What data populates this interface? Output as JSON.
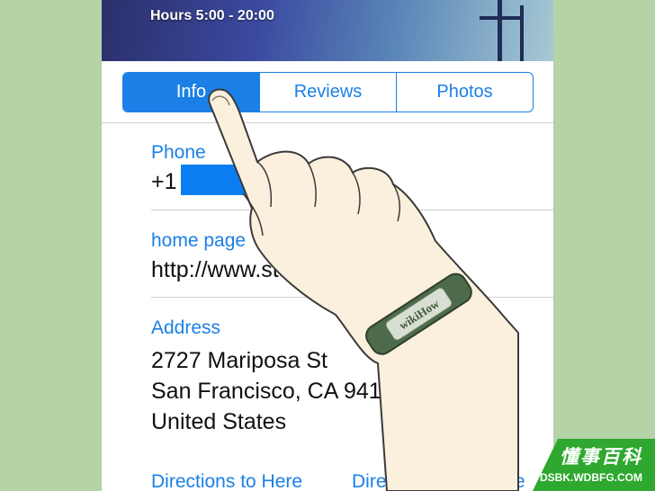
{
  "banner": {
    "hours": "Hours 5:00 - 20:00"
  },
  "tabs": [
    {
      "label": "Info",
      "active": true
    },
    {
      "label": "Reviews",
      "active": false
    },
    {
      "label": "Photos",
      "active": false
    }
  ],
  "phone": {
    "label": "Phone",
    "value": "+1"
  },
  "homepage": {
    "label": "home page",
    "value": "http://www.starbucks.com/"
  },
  "address": {
    "label": "Address",
    "lines": [
      "2727 Mariposa St",
      "San Francisco, CA  94110-1482",
      "United States"
    ]
  },
  "links": {
    "directions_to": "Directions to Here",
    "directions_from": "Directions from Here"
  },
  "bracelet": {
    "text": "wikiHow"
  },
  "watermark": {
    "zh": "懂事百科",
    "en": "DSBK.WDBFG.COM"
  },
  "colors": {
    "accent": "#1a80e6",
    "background": "#b5d3a6",
    "watermark": "#2ea82e"
  },
  "icons": [
    "pointing-hand-illustration",
    "wikihow-bracelet"
  ]
}
